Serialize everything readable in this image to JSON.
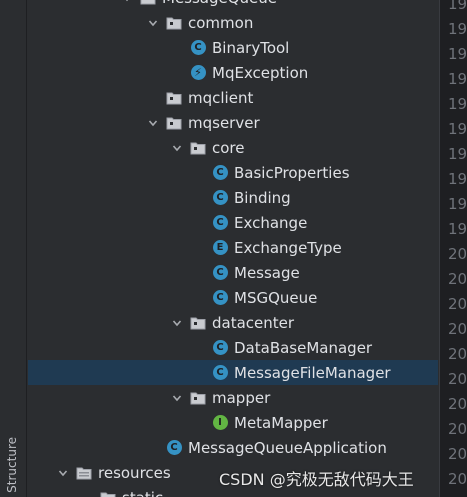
{
  "side_panel": {
    "structure_label": "Structure"
  },
  "tree": {
    "items": [
      {
        "label": "MessageQueue",
        "kind": "folder",
        "expanded": true
      },
      {
        "label": "common",
        "kind": "package",
        "expanded": true
      },
      {
        "label": "BinaryTool",
        "kind": "class",
        "icon_letter": "C"
      },
      {
        "label": "MqException",
        "kind": "exception",
        "icon_letter": "⚡"
      },
      {
        "label": "mqclient",
        "kind": "package"
      },
      {
        "label": "mqserver",
        "kind": "package",
        "expanded": true
      },
      {
        "label": "core",
        "kind": "package",
        "expanded": true
      },
      {
        "label": "BasicProperties",
        "kind": "class",
        "icon_letter": "C"
      },
      {
        "label": "Binding",
        "kind": "class",
        "icon_letter": "C"
      },
      {
        "label": "Exchange",
        "kind": "class",
        "icon_letter": "C"
      },
      {
        "label": "ExchangeType",
        "kind": "enum",
        "icon_letter": "E"
      },
      {
        "label": "Message",
        "kind": "class",
        "icon_letter": "C"
      },
      {
        "label": "MSGQueue",
        "kind": "class",
        "icon_letter": "C"
      },
      {
        "label": "datacenter",
        "kind": "package",
        "expanded": true
      },
      {
        "label": "DataBaseManager",
        "kind": "class",
        "icon_letter": "C"
      },
      {
        "label": "MessageFileManager",
        "kind": "class",
        "icon_letter": "C",
        "selected": true
      },
      {
        "label": "mapper",
        "kind": "package",
        "expanded": true
      },
      {
        "label": "MetaMapper",
        "kind": "interface",
        "icon_letter": "I"
      },
      {
        "label": "MessageQueueApplication",
        "kind": "app-class",
        "icon_letter": "C"
      },
      {
        "label": "resources",
        "kind": "resource-folder",
        "expanded": true
      },
      {
        "label": "static",
        "kind": "folder"
      }
    ]
  },
  "gutter": {
    "line_numbers": [
      "19",
      "19",
      "19",
      "19",
      "19",
      "19",
      "19",
      "19",
      "19",
      "19",
      "20",
      "20",
      "20",
      "20",
      "20",
      "20",
      "20",
      "20",
      "20",
      "20",
      "21"
    ]
  },
  "watermark": {
    "text": "CSDN @究极无敌代码大王"
  },
  "colors": {
    "background": "#2b2d30",
    "selection": "#1f3a52",
    "class_icon": "#3592c4",
    "interface_icon": "#62b543",
    "text": "#dfe1e5",
    "line_number": "#6f737a"
  }
}
